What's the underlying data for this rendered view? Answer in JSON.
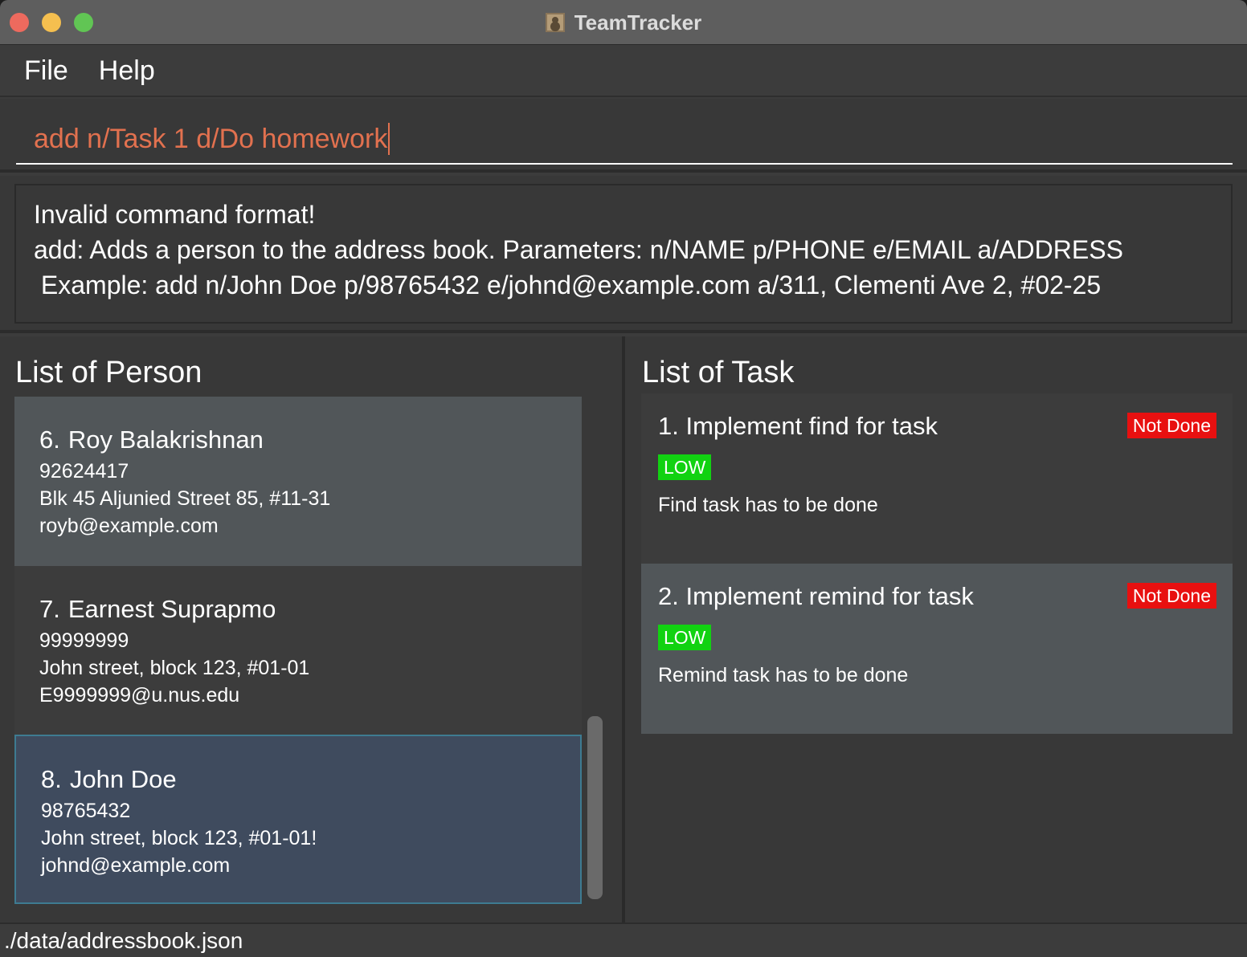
{
  "window": {
    "title": "TeamTracker"
  },
  "menu": {
    "file": "File",
    "help": "Help"
  },
  "command": {
    "value": "add n/Task 1 d/Do homework"
  },
  "result": {
    "lines": [
      "Invalid command format!",
      "add: Adds a person to the address book. Parameters: n/NAME p/PHONE e/EMAIL a/ADDRESS",
      " Example: add n/John Doe p/98765432 e/johnd@example.com a/311, Clementi Ave 2, #02-25"
    ]
  },
  "persons": {
    "title": "List of Person",
    "items": [
      {
        "index": "6.",
        "name": "Roy Balakrishnan",
        "phone": "92624417",
        "address": "Blk 45 Aljunied Street 85, #11-31",
        "email": "royb@example.com"
      },
      {
        "index": "7.",
        "name": "Earnest Suprapmo",
        "phone": "99999999",
        "address": "John street, block 123, #01-01",
        "email": "E9999999@u.nus.edu"
      },
      {
        "index": "8.",
        "name": "John Doe",
        "phone": "98765432",
        "address": "John street, block 123, #01-01!",
        "email": "johnd@example.com"
      }
    ]
  },
  "tasks": {
    "title": "List of Task",
    "items": [
      {
        "name": "1. Implement find for task",
        "status": "Not Done",
        "priority": "LOW",
        "description": "Find task has to be done"
      },
      {
        "name": "2. Implement remind for task",
        "status": "Not Done",
        "priority": "LOW",
        "description": "Remind task has to be done"
      }
    ]
  },
  "statusbar": {
    "path": "./data/addressbook.json"
  },
  "colors": {
    "accent_command": "#e2714f",
    "status_not_done": "#e81010",
    "priority_low": "#11d211",
    "selected_border": "#3e7b91"
  }
}
